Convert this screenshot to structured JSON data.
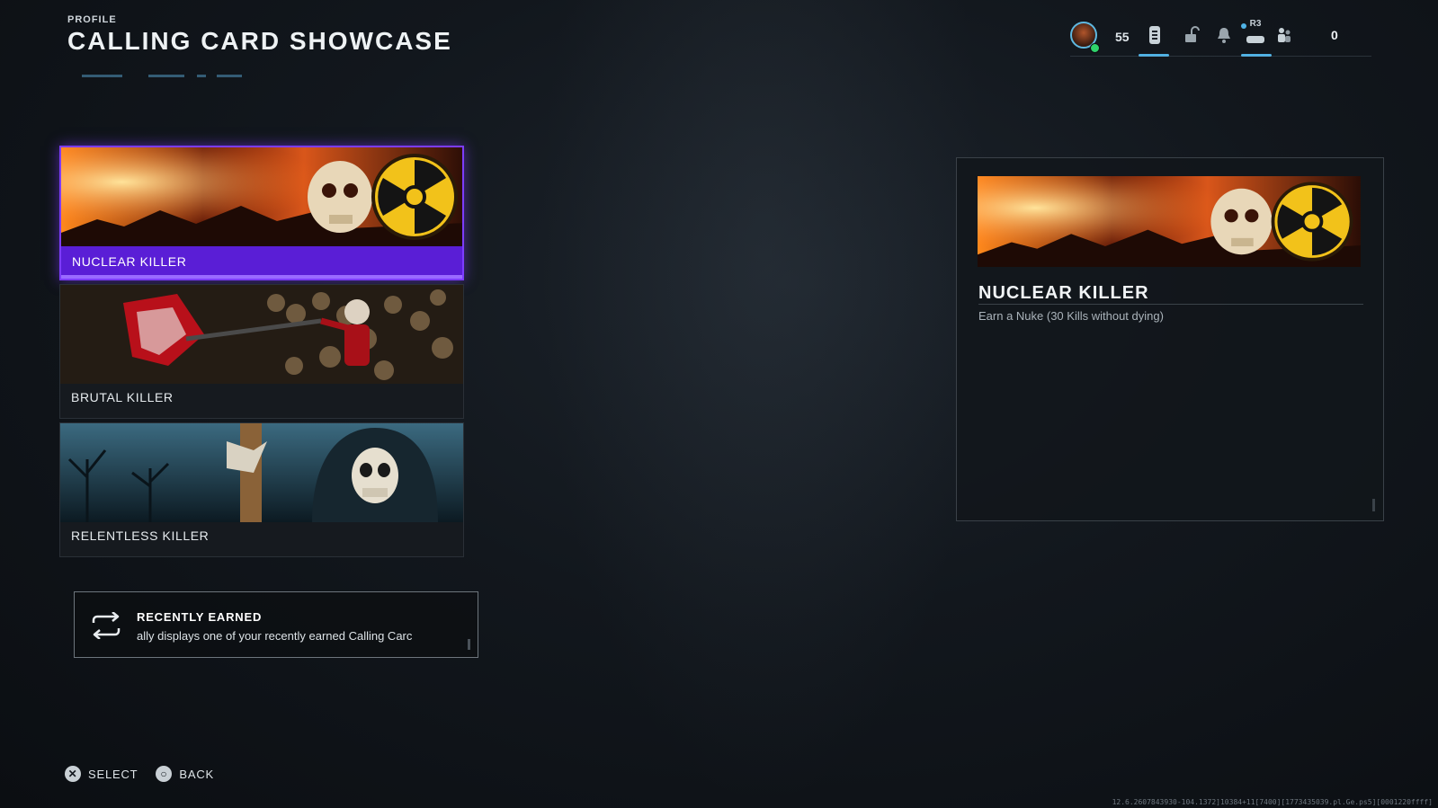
{
  "header": {
    "crumb": "PROFILE",
    "title": "CALLING CARD SHOWCASE"
  },
  "topbar": {
    "level": "55",
    "currency": "0",
    "r3_label": "R3",
    "icons": [
      "player-avatar-icon",
      "tablet-icon",
      "unlock-icon",
      "bell-icon",
      "controller-icon",
      "party-icon"
    ]
  },
  "cards": [
    {
      "label": "NUCLEAR KILLER",
      "selected": true
    },
    {
      "label": "BRUTAL KILLER",
      "selected": false
    },
    {
      "label": "RELENTLESS KILLER",
      "selected": false
    }
  ],
  "recent": {
    "title": "RECENTLY EARNED",
    "description": "ally displays one of your recently earned Calling Carc"
  },
  "detail": {
    "title": "NUCLEAR KILLER",
    "description": "Earn a Nuke (30 Kills without dying)"
  },
  "footer": {
    "select_glyph": "✕",
    "select_label": "SELECT",
    "back_glyph": "○",
    "back_label": "BACK",
    "build": "12.6.2607843930-104.1372]10384+11[7400][1773435039.pl.Ge.ps5][0001220ffff]"
  },
  "colors": {
    "accent_purple": "#5a1ed6",
    "accent_blue": "#4fb3e6",
    "online": "#2fd36b"
  }
}
